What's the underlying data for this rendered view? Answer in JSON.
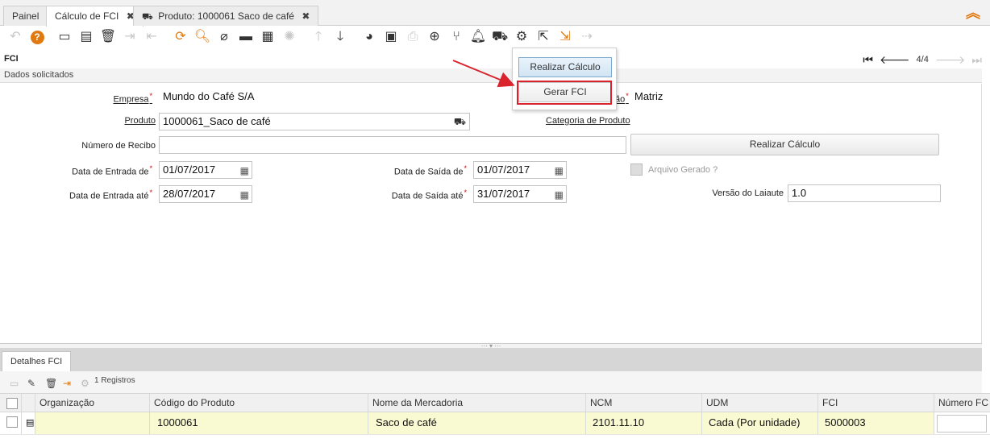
{
  "tabs": [
    {
      "label": "Painel"
    },
    {
      "label": "Cálculo de FCI",
      "close": "✖"
    },
    {
      "label": "Produto: 1000061 Saco de café",
      "close": "✖"
    }
  ],
  "window": {
    "title": "FCI",
    "record_nav": "4/4",
    "section": "Dados solicitados"
  },
  "form": {
    "empresa_label": "Empresa",
    "empresa_value": "Mundo do Café S/A",
    "org_label_tail": "ão",
    "org_value": "Matriz",
    "produto_label": "Produto",
    "produto_value": "1000061_Saco de café",
    "categoria_label": "Categoria de Produto",
    "recibo_label": "Número de Recibo",
    "recibo_value": "",
    "realizar_label": "Realizar Cálculo",
    "entrada_de_label": "Data de Entrada de",
    "entrada_de_value": "01/07/2017",
    "saida_de_label": "Data de Saída de",
    "saida_de_value": "01/07/2017",
    "arquivo_label": "Arquivo Gerado ?",
    "entrada_ate_label": "Data de Entrada até",
    "entrada_ate_value": "28/07/2017",
    "saida_ate_label": "Data de Saída até",
    "saida_ate_value": "31/07/2017",
    "versao_label": "Versão do Laiaute",
    "versao_value": "1.0",
    "required_mark": "*"
  },
  "popup": {
    "realizar": "Realizar Cálculo",
    "gerar": "Gerar FCI"
  },
  "detail": {
    "tab": "Detalhes FCI",
    "record_count": "1 Registros",
    "columns": [
      "Organização",
      "Código do Produto",
      "Nome da Mercadoria",
      "NCM",
      "UDM",
      "FCI",
      "Número FC"
    ],
    "rows": [
      {
        "org": "",
        "codigo": "1000061",
        "nome": "Saco de café",
        "ncm": "2101.11.10",
        "udm": "Cada (Por unidade)",
        "fci": "5000003"
      }
    ]
  },
  "icons": {
    "cart": "🛒",
    "calendar": "▦"
  },
  "colors": {
    "accent_orange": "#e07a10",
    "highlight_red": "#d9232d",
    "required_red": "#dd0000"
  }
}
